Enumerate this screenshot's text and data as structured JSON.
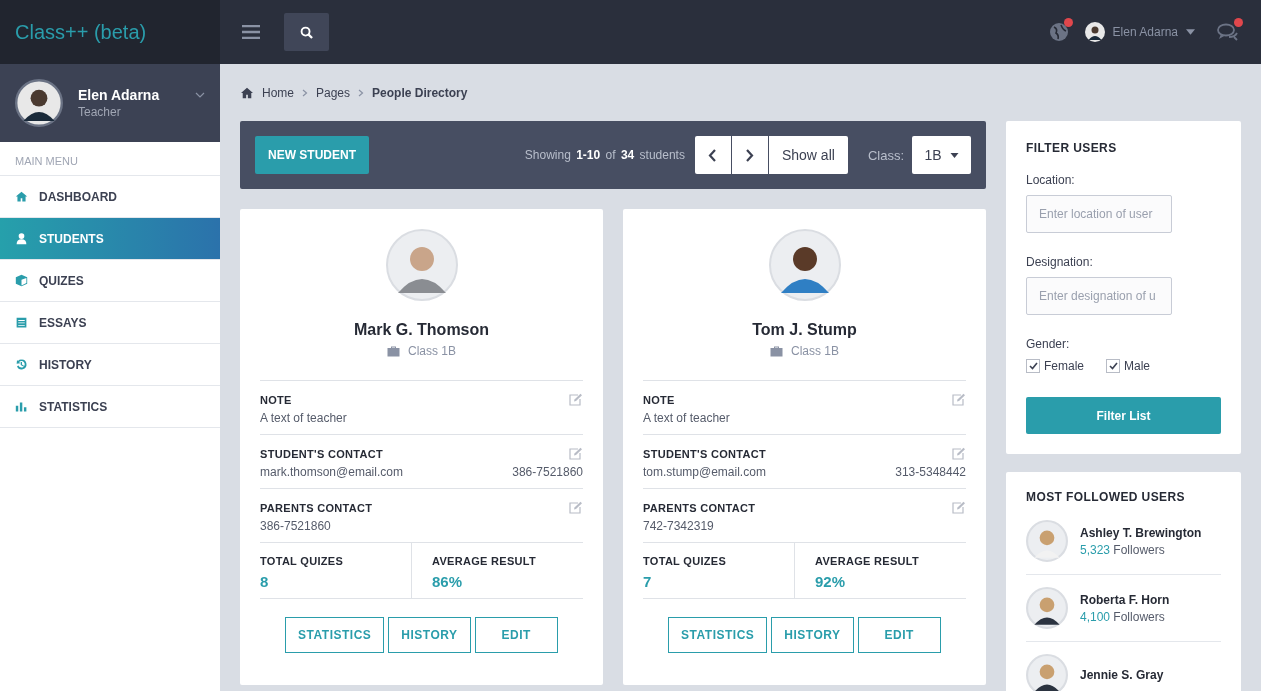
{
  "brand": "Class++ (beta)",
  "topbar": {
    "user": "Elen Adarna",
    "alerts": [
      {
        "kind": "globe",
        "badge": true
      },
      {
        "kind": "chat",
        "badge": true
      }
    ]
  },
  "profile": {
    "name": "Elen Adarna",
    "role": "Teacher"
  },
  "sidebar": {
    "heading": "MAIN MENU",
    "items": [
      {
        "label": "DASHBOARD",
        "kind": "home",
        "selected": false
      },
      {
        "label": "STUDENTS",
        "kind": "user",
        "selected": true
      },
      {
        "label": "QUIZES",
        "kind": "cube",
        "selected": false
      },
      {
        "label": "ESSAYS",
        "kind": "list",
        "selected": false
      },
      {
        "label": "HISTORY",
        "kind": "history",
        "selected": false
      },
      {
        "label": "STATISTICS",
        "kind": "chart",
        "selected": false
      }
    ]
  },
  "breadcrumb": [
    {
      "label": "Home",
      "current": false
    },
    {
      "label": "Pages",
      "current": false
    },
    {
      "label": "People Directory",
      "current": true
    }
  ],
  "toolbar": {
    "new_button": "NEW STUDENT",
    "showing": "Showing **1-10** of **34** students",
    "show_all": "Show all",
    "class_label": "Class:",
    "class_value": "1B"
  },
  "students": [
    {
      "name": "Mark G. Thomson",
      "class": "Class 1B",
      "sections": [
        {
          "label": "NOTE",
          "value": "A text of teacher"
        },
        {
          "label": "STUDENT'S CONTACT",
          "value": "mark.thomson@email.com",
          "extra": "386-7521860"
        },
        {
          "label": "PARENTS CONTACT",
          "value": "386-7521860"
        }
      ],
      "stats": [
        {
          "label": "TOTAL QUIZES",
          "value": "8"
        },
        {
          "label": "AVERAGE RESULT",
          "value": "86%"
        }
      ],
      "buttons": [
        "STATISTICS",
        "HISTORY",
        "EDIT"
      ]
    },
    {
      "name": "Tom J. Stump",
      "class": "Class 1B",
      "sections": [
        {
          "label": "NOTE",
          "value": "A text of teacher"
        },
        {
          "label": "STUDENT'S CONTACT",
          "value": "tom.stump@email.com",
          "extra": "313-5348442"
        },
        {
          "label": "PARENTS CONTACT",
          "value": "742-7342319"
        }
      ],
      "stats": [
        {
          "label": "TOTAL QUIZES",
          "value": "7"
        },
        {
          "label": "AVERAGE RESULT",
          "value": "92%"
        }
      ],
      "buttons": [
        "STATISTICS",
        "HISTORY",
        "EDIT"
      ]
    }
  ],
  "filter": {
    "title": "FILTER USERS",
    "fields": [
      {
        "label": "Location:",
        "placeholder": "Enter location of user"
      },
      {
        "label": "Designation:",
        "placeholder": "Enter designation of u"
      }
    ],
    "gender_label": "Gender:",
    "options": [
      {
        "label": "Female",
        "checked": true
      },
      {
        "label": "Male",
        "checked": true
      }
    ],
    "button": "Filter List"
  },
  "followed": {
    "title": "MOST FOLLOWED USERS",
    "users": [
      {
        "name": "Ashley T. Brewington",
        "count": "5,323",
        "suffix": "Followers"
      },
      {
        "name": "Roberta F. Horn",
        "count": "4,100",
        "suffix": "Followers"
      },
      {
        "name": "Jennie S. Gray"
      }
    ]
  }
}
